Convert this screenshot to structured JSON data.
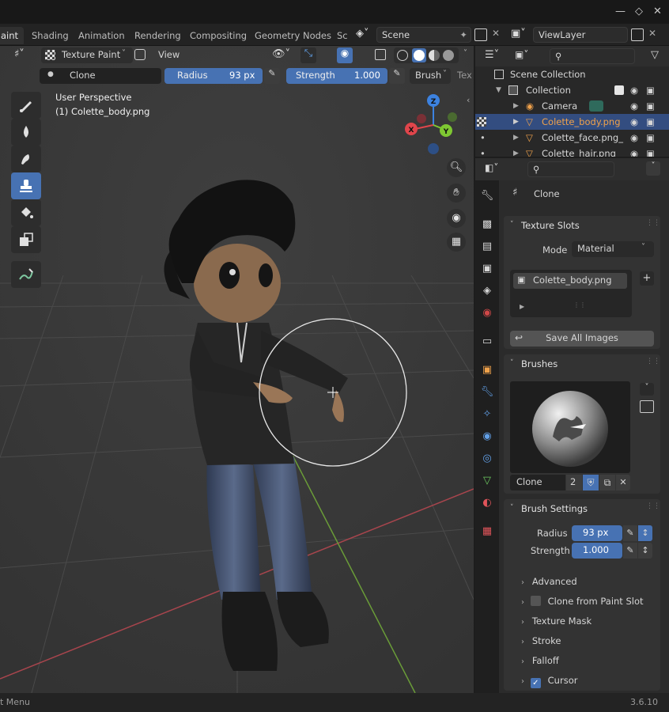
{
  "topbar": {
    "workspace_tabs": [
      "aint",
      "Shading",
      "Animation",
      "Rendering",
      "Compositing",
      "Geometry Nodes",
      "Sc"
    ],
    "scene_name": "Scene",
    "view_layer_name": "ViewLayer"
  },
  "viewport": {
    "header": {
      "mode_label": "Texture Paint",
      "view_menu": "View"
    },
    "tool_settings": {
      "brush_name": "Clone",
      "radius_label": "Radius",
      "radius_value": "93 px",
      "strength_label": "Strength",
      "strength_value": "1.000",
      "brush_menu": "Brush",
      "tex_menu": "Tex"
    },
    "overlay_text": {
      "perspective": "User Perspective",
      "object": "(1) Colette_body.png"
    },
    "gizmo_axes": {
      "x": "X",
      "y": "Y",
      "z": "Z"
    }
  },
  "outliner": {
    "scene_collection": "Scene Collection",
    "collection": "Collection",
    "items": [
      {
        "name": "Camera",
        "type": "camera",
        "selected": false
      },
      {
        "name": "Colette_body.png",
        "type": "mesh",
        "selected": true
      },
      {
        "name": "Colette_face.png_",
        "type": "mesh",
        "selected": false
      },
      {
        "name": "Colette_hair.png",
        "type": "mesh",
        "selected": false
      }
    ]
  },
  "properties": {
    "tool_title": "Clone",
    "texture_slots": {
      "title": "Texture Slots",
      "mode_label": "Mode",
      "mode_value": "Material",
      "slot_name": "Colette_body.png",
      "save_all": "Save All Images"
    },
    "brushes": {
      "title": "Brushes",
      "brush_name": "Clone",
      "users": "2"
    },
    "brush_settings": {
      "title": "Brush Settings",
      "radius_label": "Radius",
      "radius_value": "93 px",
      "strength_label": "Strength",
      "strength_value": "1.000",
      "subpanels": [
        "Advanced",
        "Clone from Paint Slot",
        "Texture Mask",
        "Stroke",
        "Falloff",
        "Cursor"
      ]
    }
  },
  "statusbar": {
    "left_text": "t Menu",
    "version": "3.6.10"
  },
  "colors": {
    "accent": "#4772b3",
    "selected_text": "#f0a24b",
    "gizmo_x": "#e0454b",
    "gizmo_y": "#7ec832",
    "gizmo_z": "#3c82e0"
  }
}
